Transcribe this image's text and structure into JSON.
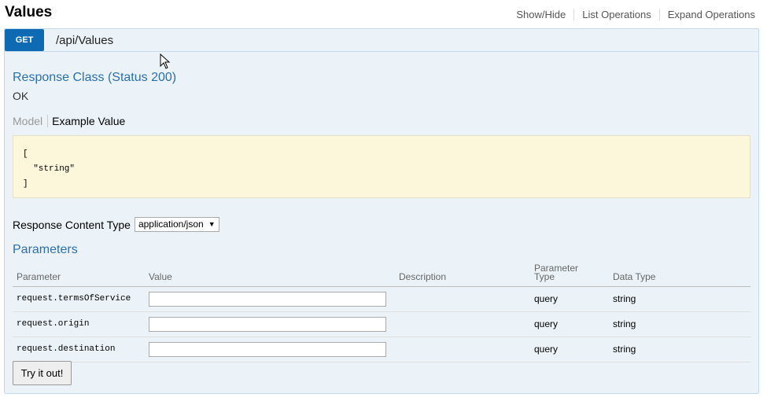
{
  "header": {
    "title": "Values",
    "links": [
      "Show/Hide",
      "List Operations",
      "Expand Operations"
    ]
  },
  "operation": {
    "method": "GET",
    "path": "/api/Values",
    "method_color": "#0f6ab4",
    "response_class_title": "Response Class (Status 200)",
    "response_status_text": "OK",
    "tabs": {
      "model": "Model",
      "example": "Example Value"
    },
    "example_value": "[\n  \"string\"\n]",
    "response_content_type_label": "Response Content Type",
    "response_content_type_value": "application/json",
    "parameters_title": "Parameters",
    "param_headers": {
      "parameter": "Parameter",
      "value": "Value",
      "description": "Description",
      "param_type_line1": "Parameter",
      "param_type_line2": "Type",
      "data_type": "Data Type"
    },
    "params": [
      {
        "name": "request.termsOfService",
        "value": "",
        "description": "",
        "param_type": "query",
        "data_type": "string"
      },
      {
        "name": "request.origin",
        "value": "",
        "description": "",
        "param_type": "query",
        "data_type": "string"
      },
      {
        "name": "request.destination",
        "value": "",
        "description": "",
        "param_type": "query",
        "data_type": "string"
      }
    ],
    "try_button": "Try it out!"
  }
}
